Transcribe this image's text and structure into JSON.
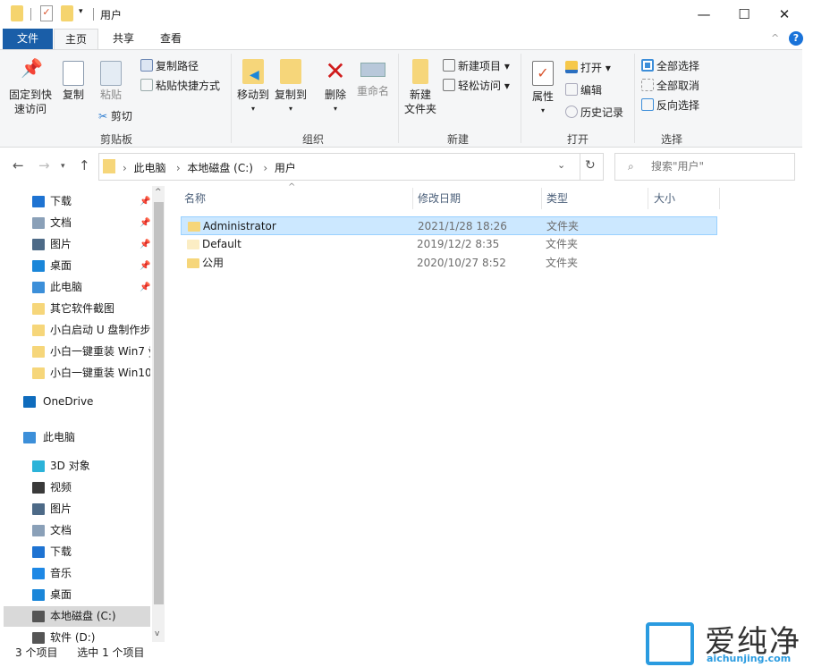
{
  "window": {
    "title": "用户",
    "minimize": "—",
    "maximize": "☐",
    "close": "✕"
  },
  "tabs": [
    {
      "label": "文件"
    },
    {
      "label": "主页"
    },
    {
      "label": "共享"
    },
    {
      "label": "查看"
    }
  ],
  "ribbon": {
    "clipboard": {
      "label": "剪贴板",
      "pin": "固定到快",
      "pin2": "速访问",
      "copy": "复制",
      "paste": "粘贴",
      "cut": "剪切",
      "copy_path": "复制路径",
      "paste_shortcut": "粘贴快捷方式"
    },
    "organize": {
      "label": "组织",
      "move_to": "移动到",
      "copy_to": "复制到",
      "delete": "删除",
      "rename": "重命名"
    },
    "new": {
      "label": "新建",
      "new_folder": "新建",
      "new_folder2": "文件夹",
      "new_item": "新建项目 ▾",
      "easy_access": "轻松访问 ▾"
    },
    "open": {
      "label": "打开",
      "properties": "属性",
      "open": "打开 ▾",
      "edit": "编辑",
      "history": "历史记录"
    },
    "select": {
      "label": "选择",
      "select_all": "全部选择",
      "select_none": "全部取消",
      "invert": "反向选择"
    }
  },
  "address": {
    "path": [
      "此电脑",
      "本地磁盘 (C:)",
      "用户"
    ],
    "search_placeholder": "搜索\"用户\""
  },
  "sidebar": [
    {
      "label": "下载",
      "icon": "download-icon",
      "pinned": true,
      "color": "#1e73d2"
    },
    {
      "label": "文档",
      "icon": "document-icon",
      "pinned": true,
      "color": "#8aa0b8"
    },
    {
      "label": "图片",
      "icon": "pictures-icon",
      "pinned": true,
      "color": "#4d6a87"
    },
    {
      "label": "桌面",
      "icon": "desktop-icon",
      "pinned": true,
      "color": "#1a86d9"
    },
    {
      "label": "此电脑",
      "icon": "computer-icon",
      "pinned": true,
      "color": "#3c8fd9"
    },
    {
      "label": "其它软件截图",
      "icon": "folder-icon",
      "color": "#f6d67a"
    },
    {
      "label": "小白启动 U 盘制作步",
      "icon": "folder-icon",
      "color": "#f6d67a"
    },
    {
      "label": "小白一键重装 Win7 ÿ",
      "icon": "folder-icon",
      "color": "#f6d67a"
    },
    {
      "label": "小白一键重装 Win10",
      "icon": "folder-icon",
      "color": "#f6d67a"
    },
    {
      "label": "OneDrive",
      "icon": "onedrive-icon",
      "color": "#0f6cbd",
      "top": true
    },
    {
      "label": "此电脑",
      "icon": "computer-icon",
      "color": "#3c8fd9",
      "top": true
    },
    {
      "label": "3D 对象",
      "icon": "3d-objects-icon",
      "color": "#2bb3d9"
    },
    {
      "label": "视频",
      "icon": "video-icon",
      "color": "#3a3a3a"
    },
    {
      "label": "图片",
      "icon": "pictures-icon",
      "color": "#4d6a87"
    },
    {
      "label": "文档",
      "icon": "document-icon",
      "color": "#8aa0b8"
    },
    {
      "label": "下载",
      "icon": "download-icon",
      "color": "#1e73d2"
    },
    {
      "label": "音乐",
      "icon": "music-icon",
      "color": "#1e88e5"
    },
    {
      "label": "桌面",
      "icon": "desktop-icon",
      "color": "#1a86d9"
    },
    {
      "label": "本地磁盘 (C:)",
      "icon": "drive-icon",
      "color": "#555",
      "selected": true
    },
    {
      "label": "软件 (D:)",
      "icon": "drive-icon",
      "color": "#555"
    }
  ],
  "columns": [
    "名称",
    "修改日期",
    "类型",
    "大小"
  ],
  "files": [
    {
      "name": "Administrator",
      "date": "2021/1/28 18:26",
      "type": "文件夹",
      "selected": true
    },
    {
      "name": "Default",
      "date": "2019/12/2 8:35",
      "type": "文件夹",
      "faded": true
    },
    {
      "name": "公用",
      "date": "2020/10/27 8:52",
      "type": "文件夹"
    }
  ],
  "status": {
    "count": "3 个项目",
    "selected": "选中 1 个项目"
  },
  "watermark": {
    "text": "爱纯净",
    "url": "aichunjing.com"
  }
}
